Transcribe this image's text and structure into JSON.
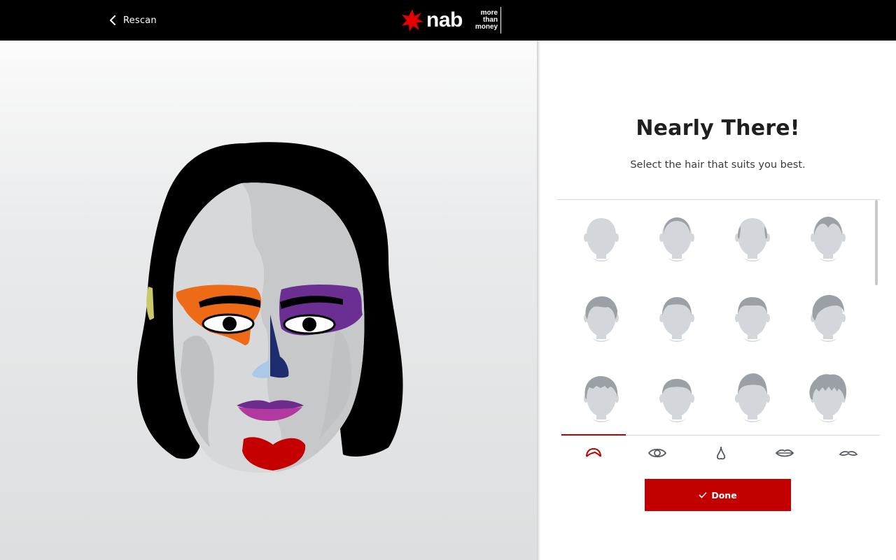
{
  "header": {
    "back_label": "Rescan",
    "brand_word": "nab",
    "brand_tagline": [
      "more",
      "than",
      "money"
    ]
  },
  "panel": {
    "title": "Nearly There!",
    "subtitle": "Select the hair that suits you best."
  },
  "hair_options": [
    {
      "style": "bald"
    },
    {
      "style": "receding-crown"
    },
    {
      "style": "thin-sides"
    },
    {
      "style": "widows-peak"
    },
    {
      "style": "short-wavy"
    },
    {
      "style": "short-crop"
    },
    {
      "style": "short-flat"
    },
    {
      "style": "side-swept"
    },
    {
      "style": "textured"
    },
    {
      "style": "crew-cut"
    },
    {
      "style": "quiff"
    },
    {
      "style": "curly"
    }
  ],
  "category_tabs": [
    {
      "name": "hair",
      "icon": "hair-icon",
      "active": true
    },
    {
      "name": "eyes",
      "icon": "eye-icon",
      "active": false
    },
    {
      "name": "nose",
      "icon": "nose-icon",
      "active": false
    },
    {
      "name": "lips",
      "icon": "lips-icon",
      "active": false
    },
    {
      "name": "moustache",
      "icon": "moustache-icon",
      "active": false
    }
  ],
  "done_button": {
    "label": "Done",
    "icon": "check-icon"
  },
  "colors": {
    "accent_red": "#c20000",
    "header_bg": "#000000",
    "avatar_placeholder": "#d3d6da",
    "avatar_hair": "#9aa0a5"
  }
}
